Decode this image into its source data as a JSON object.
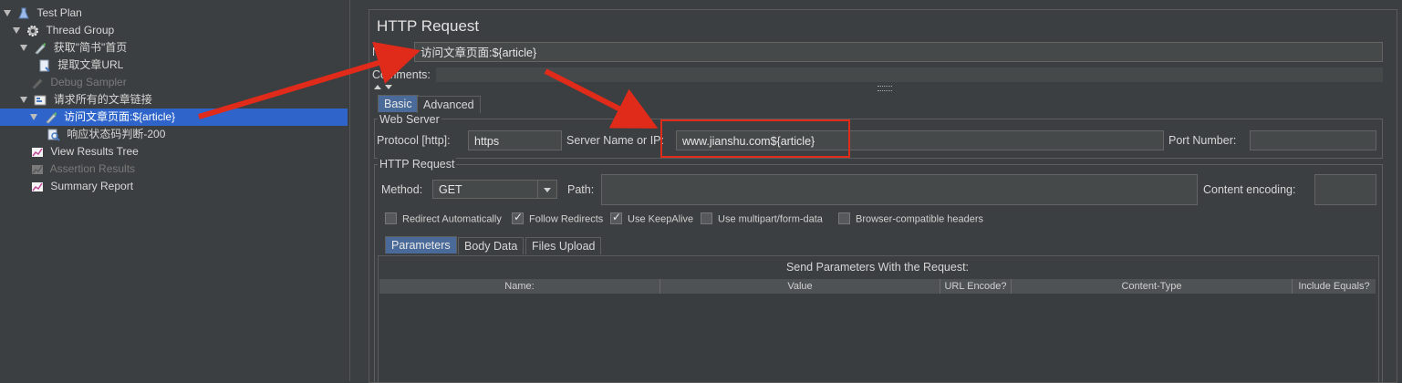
{
  "tree": {
    "items": [
      {
        "label": "Test Plan",
        "icon": "test-plan-icon",
        "dim": false,
        "selected": false
      },
      {
        "label": "Thread Group",
        "icon": "gear-icon",
        "dim": false,
        "selected": false
      },
      {
        "label": "获取\"简书\"首页",
        "icon": "http-sampler-icon",
        "dim": false,
        "selected": false
      },
      {
        "label": "提取文章URL",
        "icon": "extractor-icon",
        "dim": false,
        "selected": false
      },
      {
        "label": "Debug Sampler",
        "icon": "debug-sampler-icon",
        "dim": true,
        "selected": false
      },
      {
        "label": "请求所有的文章链接",
        "icon": "foreach-controller-icon",
        "dim": false,
        "selected": false
      },
      {
        "label": "访问文章页面:${article}",
        "icon": "http-sampler-icon",
        "dim": false,
        "selected": true
      },
      {
        "label": "响应状态码判断-200",
        "icon": "assertion-icon",
        "dim": false,
        "selected": false
      },
      {
        "label": "View Results Tree",
        "icon": "listener-icon",
        "dim": false,
        "selected": false
      },
      {
        "label": "Assertion Results",
        "icon": "listener-icon",
        "dim": true,
        "selected": false
      },
      {
        "label": "Summary Report",
        "icon": "listener-icon",
        "dim": false,
        "selected": false
      }
    ]
  },
  "panel": {
    "title": "HTTP Request",
    "name_label": "Name:",
    "name_value": "访问文章页面:${article}",
    "comments_label": "Comments:",
    "tabs": [
      "Basic",
      "Advanced"
    ],
    "web_server": {
      "title": "Web Server",
      "protocol_label": "Protocol [http]:",
      "protocol_value": "https",
      "server_label": "Server Name or IP:",
      "server_value": "www.jianshu.com${article}",
      "port_label": "Port Number:",
      "port_value": ""
    },
    "http_request": {
      "title": "HTTP Request",
      "method_label": "Method:",
      "method_value": "GET",
      "path_label": "Path:",
      "path_value": "",
      "encoding_label": "Content encoding:",
      "encoding_value": ""
    },
    "checkboxes": [
      {
        "label": "Redirect Automatically",
        "checked": false
      },
      {
        "label": "Follow Redirects",
        "checked": true
      },
      {
        "label": "Use KeepAlive",
        "checked": true
      },
      {
        "label": "Use multipart/form-data",
        "checked": false
      },
      {
        "label": "Browser-compatible headers",
        "checked": false
      }
    ],
    "sub_tabs": [
      "Parameters",
      "Body Data",
      "Files Upload"
    ],
    "params_title": "Send Parameters With the Request:",
    "columns": [
      "Name:",
      "Value",
      "URL Encode?",
      "Content-Type",
      "Include Equals?"
    ]
  },
  "colors": {
    "selection": "#2f65ca",
    "annotation": "#e02a1a"
  }
}
